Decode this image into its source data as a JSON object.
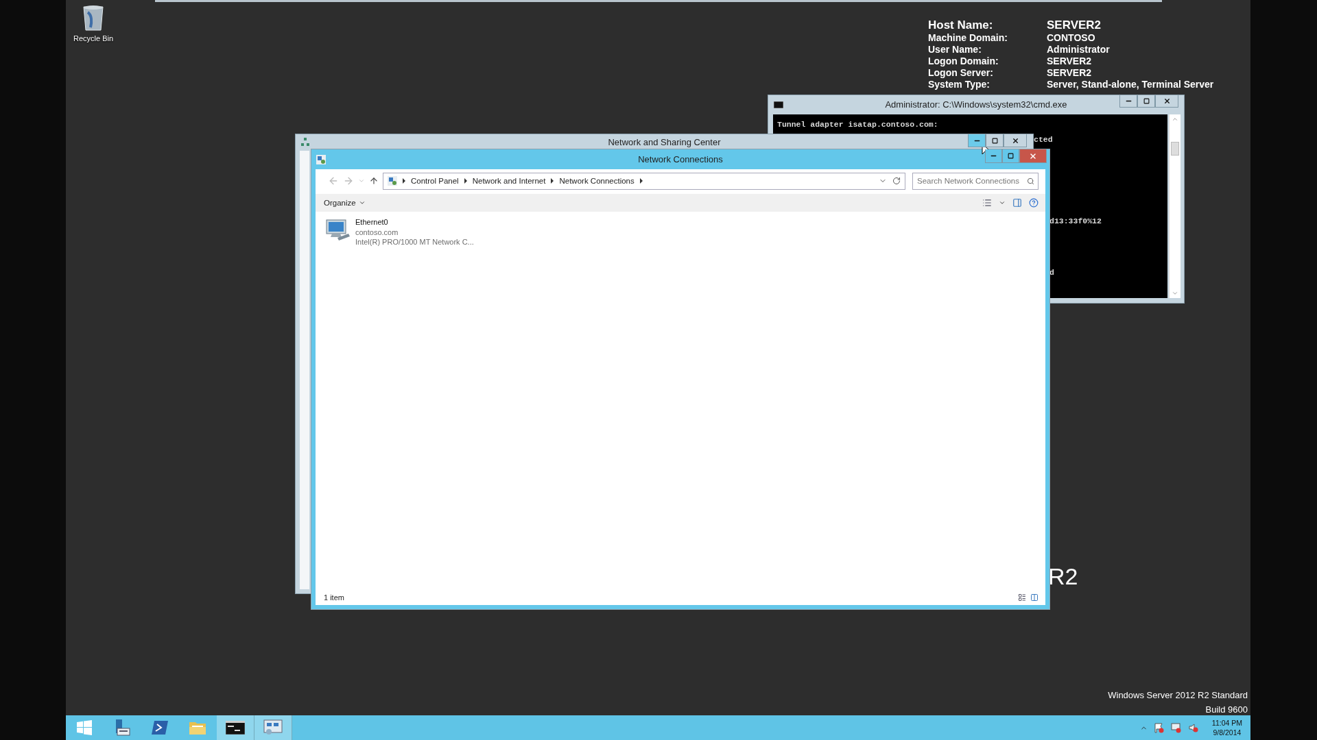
{
  "desktop_icons": [
    {
      "label": "Recycle Bin"
    }
  ],
  "system_info": [
    {
      "label": "Host Name:",
      "value": "SERVER2"
    },
    {
      "label": "Machine Domain:",
      "value": "CONTOSO"
    },
    {
      "label": "User Name:",
      "value": "Administrator"
    },
    {
      "label": "Logon Domain:",
      "value": "SERVER2"
    },
    {
      "label": "Logon Server:",
      "value": "SERVER2"
    },
    {
      "label": "System Type:",
      "value": "Server, Stand-alone, Terminal Server"
    }
  ],
  "cmd_window": {
    "title": "Administrator: C:\\Windows\\system32\\cmd.exe",
    "lines": [
      "Tunnel adapter isatap.contoso.com:",
      "cted",
      "d13:33f0%12",
      "d"
    ]
  },
  "sharing_center_window": {
    "title": "Network and Sharing Center",
    "minimize_hovered": true
  },
  "connections_window": {
    "title": "Network Connections",
    "breadcrumb": [
      "Control Panel",
      "Network and Internet",
      "Network Connections"
    ],
    "search": {
      "placeholder": "Search Network Connections"
    },
    "organize": "Organize",
    "items": [
      {
        "name": "Ethernet0",
        "network": "contoso.com",
        "adapter": "Intel(R) PRO/1000 MT Network C..."
      }
    ],
    "status": "1 item"
  },
  "wallpaper_text": "R2",
  "edition": [
    "Windows Server 2012 R2 Standard",
    "Build 9600"
  ],
  "taskbar": {
    "apps": [
      {
        "kind": "start",
        "active": false
      },
      {
        "kind": "server-manager",
        "active": false
      },
      {
        "kind": "powershell",
        "active": false
      },
      {
        "kind": "explorer",
        "active": false
      },
      {
        "kind": "cmd",
        "active": true
      },
      {
        "kind": "network",
        "active": true
      }
    ],
    "clock": {
      "time": "11:04 PM",
      "date": "9/8/2014"
    }
  }
}
